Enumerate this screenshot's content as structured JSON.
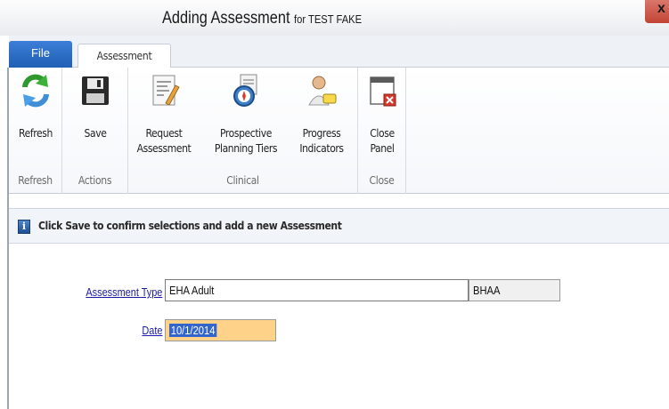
{
  "window": {
    "title_main": "Adding Assessment",
    "title_suffix": "for TEST FAKE",
    "close_glyph": "x"
  },
  "tabs": [
    {
      "label": "File"
    },
    {
      "label": "Assessment"
    }
  ],
  "ribbon": {
    "groups": [
      {
        "label": "Refresh",
        "buttons": [
          {
            "label": "Refresh",
            "icon": "refresh-icon"
          }
        ]
      },
      {
        "label": "Actions",
        "buttons": [
          {
            "label": "Save",
            "icon": "save-icon"
          }
        ]
      },
      {
        "label": "Clinical",
        "buttons": [
          {
            "label_line1": "Request",
            "label_line2": "Assessment",
            "icon": "request-assessment-icon"
          },
          {
            "label_line1": "Prospective",
            "label_line2": "Planning Tiers",
            "icon": "planning-compass-icon"
          },
          {
            "label_line1": "Progress",
            "label_line2": "Indicators",
            "icon": "progress-indicators-icon"
          }
        ]
      },
      {
        "label": "Close",
        "buttons": [
          {
            "label_line1": "Close",
            "label_line2": "Panel",
            "icon": "close-panel-icon"
          }
        ]
      }
    ]
  },
  "info": {
    "icon": "info-icon",
    "icon_glyph": "i",
    "message": "Click Save to confirm selections and add a new Assessment"
  },
  "form": {
    "assessment_type_label": "Assessment Type",
    "assessment_type_value": "EHA Adult",
    "assessment_type_code": "BHAA",
    "date_label": "Date",
    "date_value": "10/1/2014"
  },
  "colors": {
    "file_tab": "#2b6cc4",
    "link_label": "#1a1aa8",
    "date_field_bg": "#ffd28a",
    "selection": "#3366cc"
  }
}
